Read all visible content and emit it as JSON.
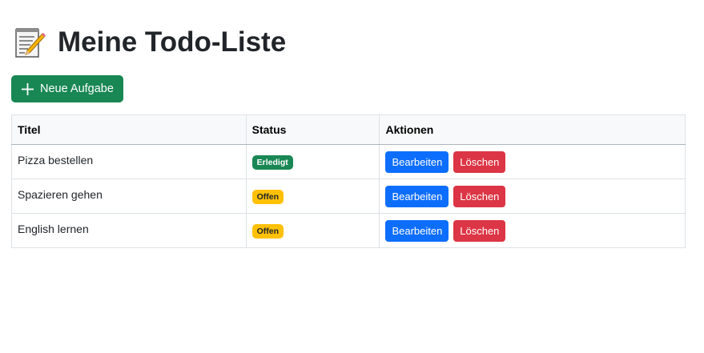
{
  "header": {
    "title": "Meine Todo-Liste",
    "icon": "memo-icon"
  },
  "toolbar": {
    "new_button_label": "Neue Aufgabe",
    "new_button_icon": "plus-icon"
  },
  "table": {
    "columns": [
      "Titel",
      "Status",
      "Aktionen"
    ],
    "rows": [
      {
        "title": "Pizza bestellen",
        "status": "Erledigt",
        "status_type": "done",
        "edit_label": "Bearbeiten",
        "delete_label": "Löschen"
      },
      {
        "title": "Spazieren gehen",
        "status": "Offen",
        "status_type": "open",
        "edit_label": "Bearbeiten",
        "delete_label": "Löschen"
      },
      {
        "title": "English lernen",
        "status": "Offen",
        "status_type": "open",
        "edit_label": "Bearbeiten",
        "delete_label": "Löschen"
      }
    ]
  },
  "colors": {
    "success": "#198754",
    "warning": "#ffc107",
    "primary": "#0d6efd",
    "danger": "#dc3545"
  }
}
